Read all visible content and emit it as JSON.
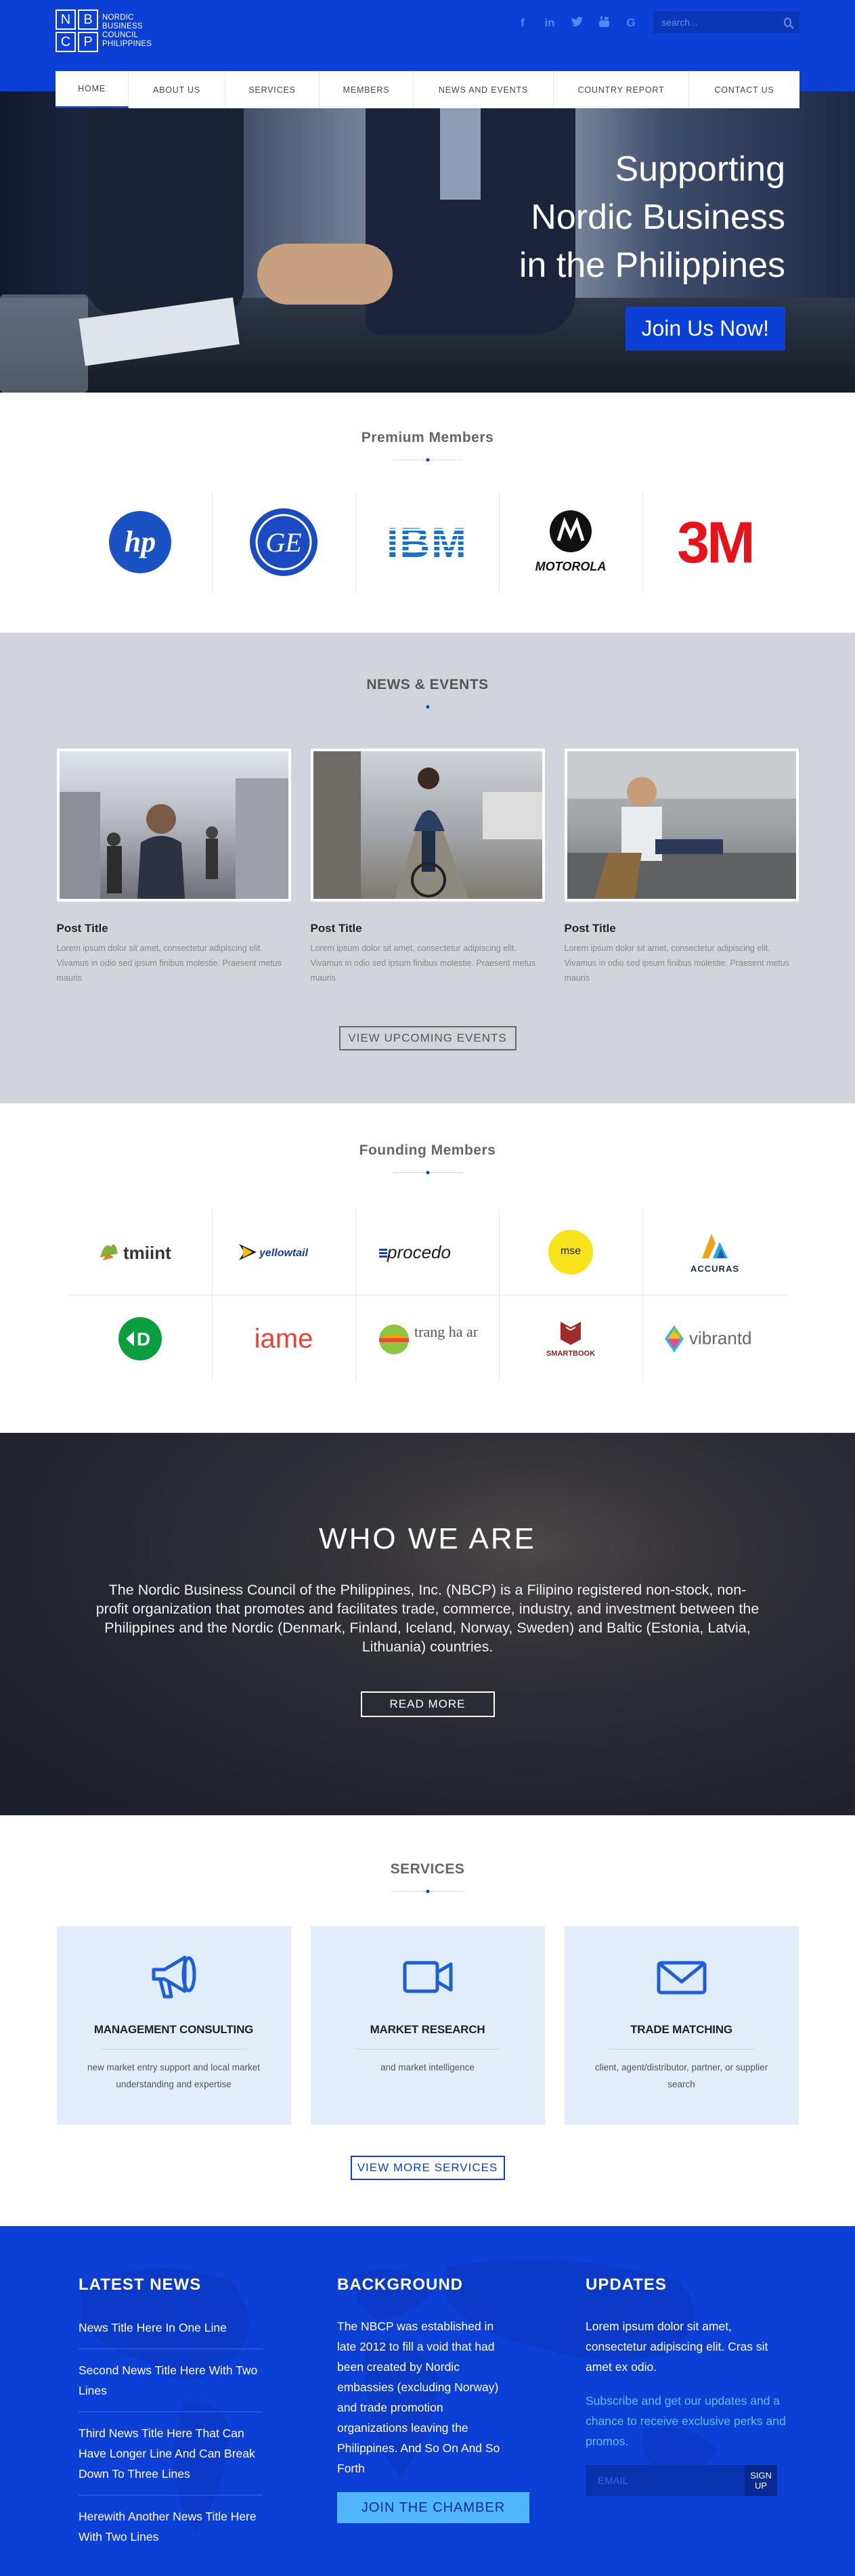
{
  "brand": {
    "logo_letters": [
      "N",
      "B",
      "C",
      "P"
    ],
    "logo_text": [
      "NORDIC",
      "BUSINESS",
      "COUNCIL",
      "PHILIPPINES"
    ],
    "primary_color": "#0c3fd6",
    "accent_color": "#50b6ff"
  },
  "header": {
    "social_icons": [
      "facebook-icon",
      "linkedin-icon",
      "twitter-icon",
      "youtube-icon",
      "google-plus-icon"
    ],
    "search_placeholder": "search..."
  },
  "nav": [
    {
      "label": "HOME",
      "active": true
    },
    {
      "label": "ABOUT US",
      "active": false
    },
    {
      "label": "SERVICES",
      "active": false
    },
    {
      "label": "MEMBERS",
      "active": false
    },
    {
      "label": "NEWS AND EVENTS",
      "active": false
    },
    {
      "label": "COUNTRY REPORT",
      "active": false
    },
    {
      "label": "CONTACT US",
      "active": false
    }
  ],
  "hero": {
    "line1": "Supporting",
    "line2": "Nordic Business",
    "line3": "in the Philippines",
    "cta": "Join Us Now!"
  },
  "premium": {
    "title": "Premium Members",
    "logos": [
      {
        "name": "hp",
        "text": "hp"
      },
      {
        "name": "ge",
        "text": "GE"
      },
      {
        "name": "ibm",
        "text": "IBM"
      },
      {
        "name": "motorola",
        "text": "MOTOROLA"
      },
      {
        "name": "3m",
        "text": "3M"
      }
    ]
  },
  "news": {
    "title": "NEWS & EVENTS",
    "posts": [
      {
        "title": "Post Title",
        "body": "Lorem ipsum dolor sit amet, consectetur adipiscing elit. Vivamus in odio sed ipsum finibus molestie. Praesent metus mauris"
      },
      {
        "title": "Post Title",
        "body": "Lorem ipsum dolor sit amet, consectetur adipiscing elit. Vivamus in odio sed ipsum finibus molestie. Praesent metus mauris"
      },
      {
        "title": "Post Title",
        "body": "Lorem ipsum dolor sit amet, consectetur adipiscing elit. Vivamus in odio sed ipsum finibus molestie. Praesent metus mauris"
      }
    ],
    "button": "VIEW UPCOMING EVENTS"
  },
  "founding": {
    "title": "Founding Members",
    "logos": [
      {
        "name": "tmiint",
        "text": "tmiint"
      },
      {
        "name": "yellowtail",
        "text": "yellowtail"
      },
      {
        "name": "procedo",
        "text": "procedo"
      },
      {
        "name": "mse",
        "text": "mse"
      },
      {
        "name": "accuras",
        "text": "ACCURAS"
      },
      {
        "name": "ld",
        "text": "D"
      },
      {
        "name": "iame",
        "text": "iame"
      },
      {
        "name": "trang-ha-anh",
        "text": "trang ha anh"
      },
      {
        "name": "smartbook",
        "text": "SMARTBOOK"
      },
      {
        "name": "vibrantd",
        "text": "vibrantd"
      }
    ]
  },
  "who": {
    "title": "WHO WE ARE",
    "body": "The Nordic Business Council of the Philippines, Inc. (NBCP) is a Filipino registered non-stock, non-profit organization that promotes and facilitates trade, commerce, industry, and investment between the Philippines and the Nordic (Denmark, Finland, Iceland, Norway, Sweden) and Baltic (Estonia, Latvia, Lithuania) countries.",
    "button": "READ MORE"
  },
  "services": {
    "title": "SERVICES",
    "items": [
      {
        "icon": "megaphone-icon",
        "title": "MANAGEMENT CONSULTING",
        "desc": "new market entry support and local market understanding and expertise"
      },
      {
        "icon": "video-camera-icon",
        "title": "MARKET RESEARCH",
        "desc": "and market intelligence"
      },
      {
        "icon": "envelope-icon",
        "title": "TRADE MATCHING",
        "desc": "client, agent/distributor, partner, or supplier search"
      }
    ],
    "button": "VIEW MORE SERVICES"
  },
  "footer": {
    "latest_news": {
      "title": "LATEST NEWS",
      "items": [
        "News Title Here In One Line",
        "Second News Title Here With Two Lines",
        "Third News Title Here That Can Have Longer Line And Can Break Down To Three Lines",
        "Herewith Another News Title Here With Two Lines"
      ]
    },
    "background": {
      "title": "BACKGROUND",
      "body": "The NBCP was established in late 2012 to fill a void that had been created by Nordic embassies (excluding Norway) and trade promotion organizations leaving the Philippines. And So On And So Forth",
      "button": "JOIN THE CHAMBER"
    },
    "updates": {
      "title": "UPDATES",
      "body": "Lorem ipsum dolor sit amet, consectetur adipiscing elit. Cras sit amet ex odio.",
      "subscribe_text": "Subscribe and get our updates and a chance to receive exclusive perks and promos.",
      "email_placeholder": "EMAIL",
      "signup": "SIGN UP"
    }
  }
}
